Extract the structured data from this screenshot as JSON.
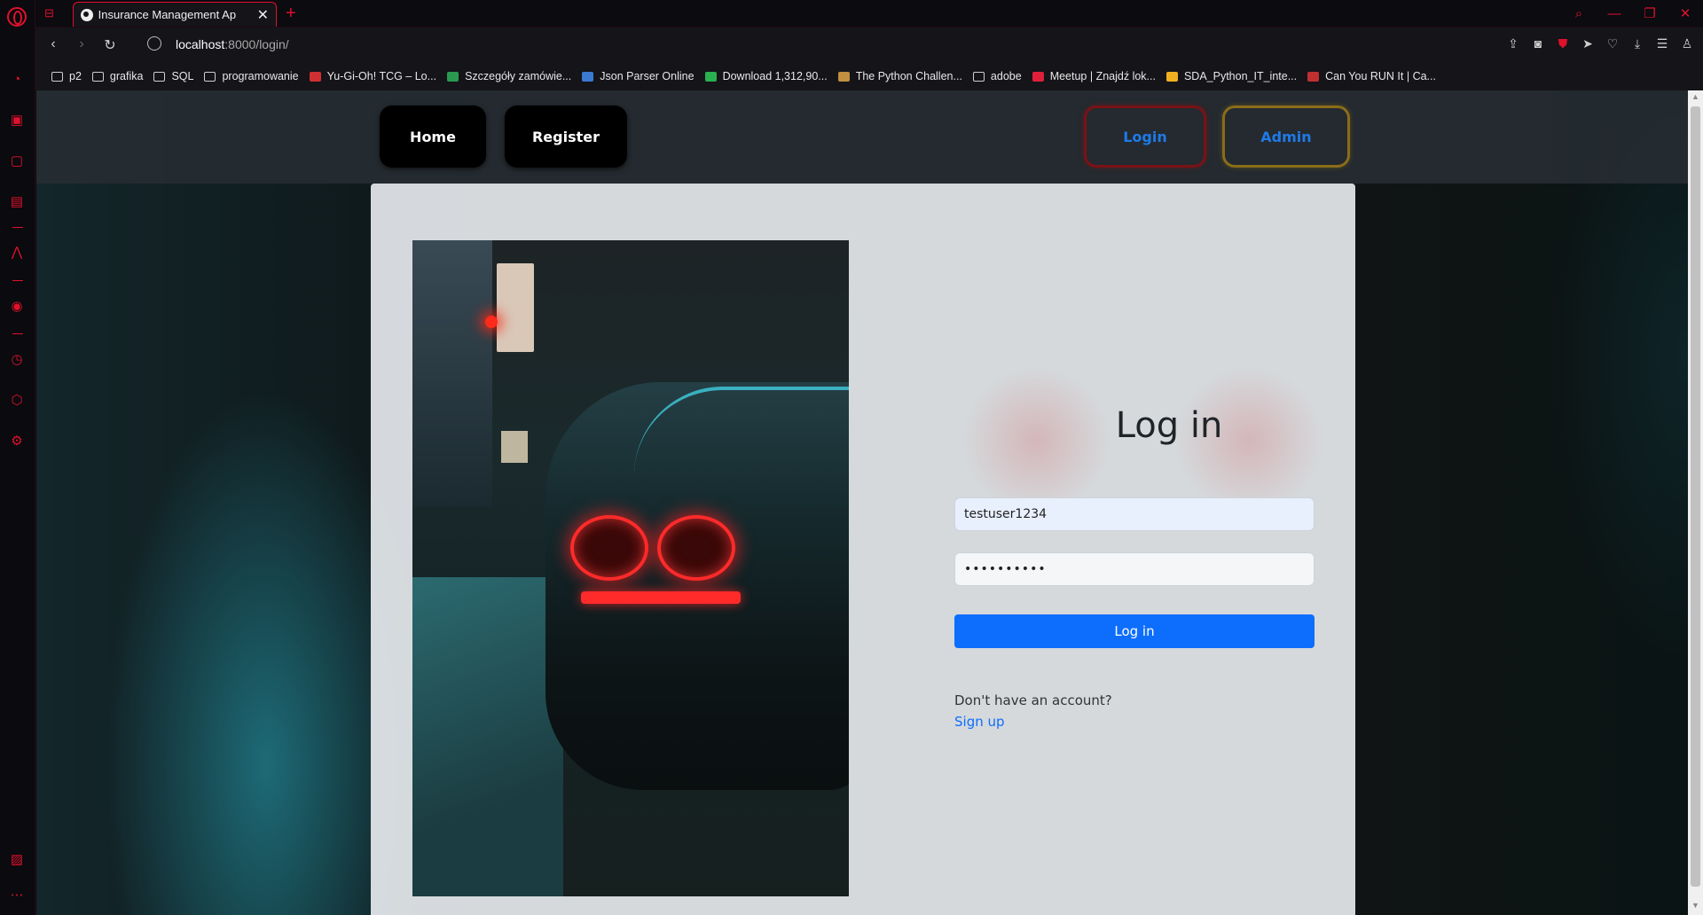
{
  "browser": {
    "tab_title": "Insurance Management Ap",
    "url_host": "localhost",
    "url_rest": ":8000/login/",
    "bookmarks": [
      {
        "label": "p2",
        "icon": "folder-icon",
        "color": "#cfcfcf"
      },
      {
        "label": "grafika",
        "icon": "folder-icon",
        "color": "#cfcfcf"
      },
      {
        "label": "SQL",
        "icon": "folder-icon",
        "color": "#cfcfcf"
      },
      {
        "label": "programowanie",
        "icon": "folder-icon",
        "color": "#cfcfcf"
      },
      {
        "label": "Yu-Gi-Oh! TCG – Lo...",
        "icon": "favicon",
        "color": "#d03030"
      },
      {
        "label": "Szczegóły zamówie...",
        "icon": "favicon",
        "color": "#2a9a50"
      },
      {
        "label": "Json Parser Online",
        "icon": "favicon",
        "color": "#3a7ad0"
      },
      {
        "label": "Download 1,312,90...",
        "icon": "favicon",
        "color": "#2ab050"
      },
      {
        "label": "The Python Challen...",
        "icon": "favicon",
        "color": "#c09040"
      },
      {
        "label": "adobe",
        "icon": "folder-icon",
        "color": "#cfcfcf"
      },
      {
        "label": "Meetup | Znajdź lok...",
        "icon": "favicon",
        "color": "#e0203a"
      },
      {
        "label": "SDA_Python_IT_inte...",
        "icon": "favicon",
        "color": "#f0b020"
      },
      {
        "label": "Can You RUN It | Ca...",
        "icon": "favicon",
        "color": "#c03030"
      }
    ]
  },
  "nav": {
    "home": "Home",
    "register": "Register",
    "login": "Login",
    "admin": "Admin"
  },
  "login_form": {
    "title": "Log in",
    "username_value": "testuser1234",
    "password_value": "••••••••••",
    "submit_label": "Log in",
    "no_account_text": "Don't have an account?",
    "signup_link": "Sign up"
  },
  "colors": {
    "accent": "#0d6efd",
    "opera_red": "#e0112b",
    "login_border": "#7a1216",
    "admin_border": "#8a6d1a"
  }
}
